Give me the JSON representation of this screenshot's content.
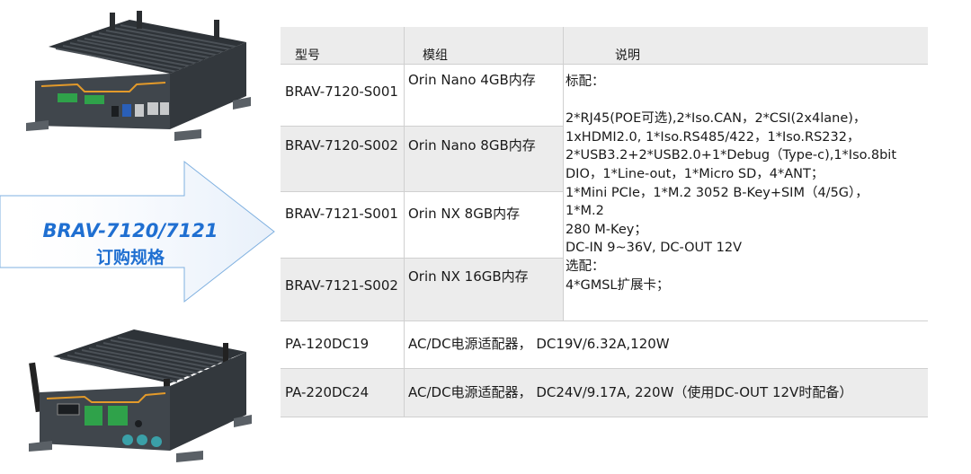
{
  "banner": {
    "title_line1": "BRAV-7120/7121",
    "title_line2": "订购规格"
  },
  "table": {
    "headers": [
      "型号",
      "模组",
      "说明"
    ],
    "rows": [
      {
        "model": "BRAV-7120-S001",
        "module": "Orin Nano 4GB内存"
      },
      {
        "model": "BRAV-7120-S002",
        "module": "Orin Nano 8GB内存"
      },
      {
        "model": "BRAV-7121-S001",
        "module": "Orin NX 8GB内存"
      },
      {
        "model": "BRAV-7121-S002",
        "module": "Orin NX 16GB内存"
      }
    ],
    "description_lines": [
      "标配：",
      "",
      "2*RJ45(POE可选),2*Iso.CAN，2*CSI(2x4lane)，",
      "1xHDMI2.0, 1*Iso.RS485/422，1*Iso.RS232，",
      "2*USB3.2+2*USB2.0+1*Debug（Type-c),1*Iso.8bit",
      "DIO，1*Line-out，1*Micro SD，4*ANT；",
      "1*Mini PCIe，1*M.2 3052 B-Key+SIM（4/5G），",
      "1*M.2",
      "280 M-Key；",
      "DC-IN 9~36V, DC-OUT 12V",
      "选配：",
      "4*GMSL扩展卡；"
    ],
    "accessories": [
      {
        "model": "PA-120DC19",
        "description": "AC/DC电源适配器， DC19V/6.32A,120W"
      },
      {
        "model": "PA-220DC24",
        "description": "AC/DC电源适配器， DC24V/9.17A, 220W（使用DC-OUT 12V时配备）"
      }
    ]
  },
  "colors": {
    "accent_blue": "#1f6fd1",
    "row_gray": "#ececec",
    "device_body": "#3a3f44",
    "terminal_green": "#2fa24a",
    "trim_orange": "#e39a2a"
  }
}
